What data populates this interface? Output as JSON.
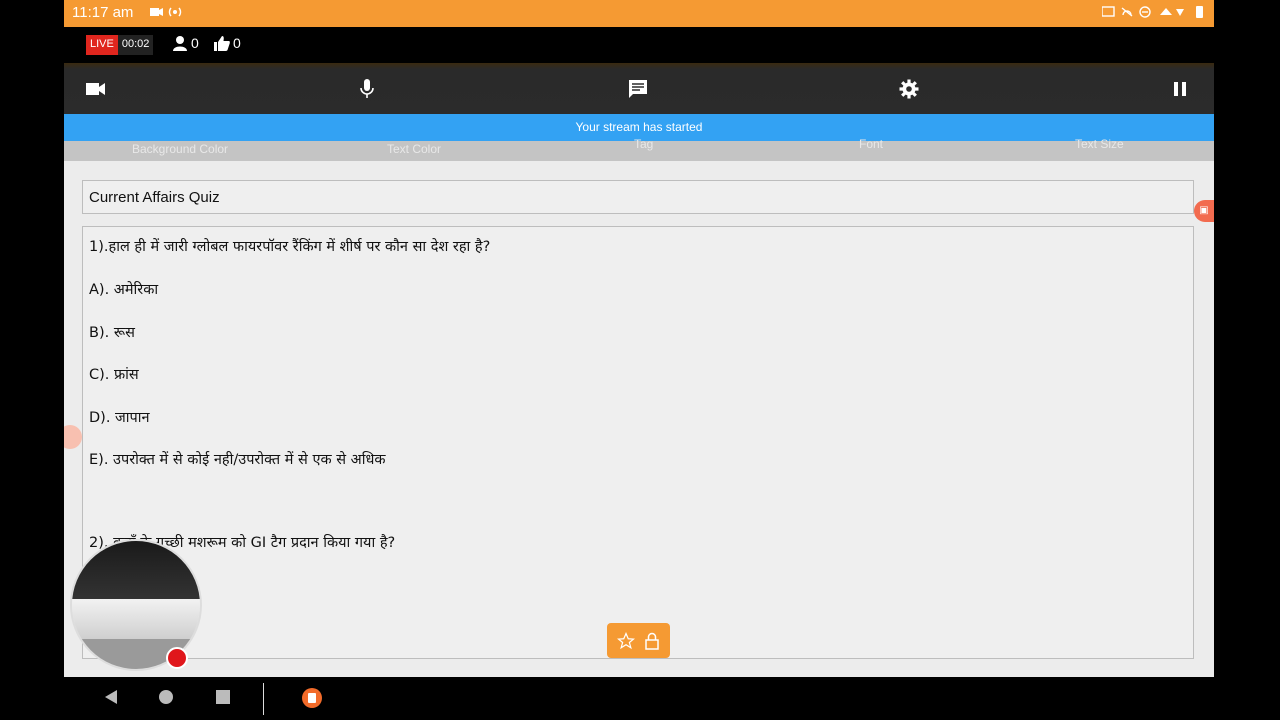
{
  "status_bar": {
    "time": "11:17 am"
  },
  "live_bar": {
    "live_label": "LIVE",
    "timer": "00:02",
    "viewer_count": "0",
    "like_count": "0"
  },
  "banner": {
    "text": "Your stream has started"
  },
  "options": {
    "background_color": "Background Color",
    "text_color": "Text Color",
    "tag": "Tag",
    "font": "Font",
    "text_size": "Text Size"
  },
  "editor": {
    "title": "Current Affairs Quiz",
    "lines": [
      "1).हाल ही में जारी ग्लोबल फायरपॉवर  रैंकिंग में शीर्ष पर कौन सा देश रहा है?",
      "A). अमेरिका",
      "B). रूस",
      "C). फ्रांस",
      "D). जापान",
      "E). उपरोक्त में से कोई नही/उपरोक्त में से एक से अधिक",
      "2). कहाँ के गुच्छी मशरूम को GI टैग प्रदान किया गया है?"
    ]
  },
  "icons": {
    "camera": "video-camera-icon",
    "mic": "microphone-icon",
    "chat": "chat-icon",
    "settings": "gear-icon",
    "pause": "pause-icon"
  },
  "colors": {
    "status_bar": "#f59a33",
    "banner": "#33a2f3",
    "live_red": "#e0261e",
    "fab": "#f59a33"
  }
}
